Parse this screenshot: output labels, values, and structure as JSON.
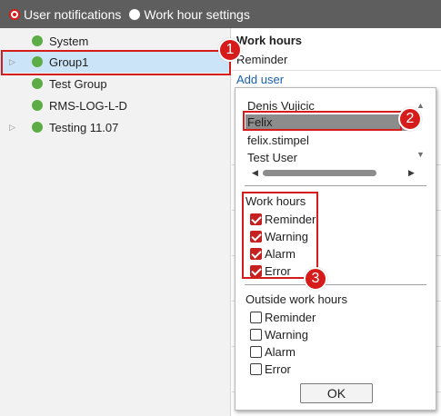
{
  "colors": {
    "topbar_bg": "#5e5e5e",
    "accent_red": "#d61b1b",
    "status_green": "#5cad45",
    "selected_row": "#cce4f7",
    "link_blue": "#1a5fb4"
  },
  "topbar": {
    "options": [
      {
        "label": "User notifications",
        "checked": true
      },
      {
        "label": "Work hour settings",
        "checked": false
      }
    ]
  },
  "tree": {
    "items": [
      {
        "label": "System",
        "expandable": false,
        "status": "green",
        "selected": false
      },
      {
        "label": "Group1",
        "expandable": true,
        "status": "green",
        "selected": true
      },
      {
        "label": "Test Group",
        "expandable": false,
        "status": "green",
        "selected": false
      },
      {
        "label": "RMS-LOG-L-D",
        "expandable": false,
        "status": "green",
        "selected": false
      },
      {
        "label": "Testing 11.07",
        "expandable": true,
        "status": "green",
        "selected": false
      }
    ]
  },
  "right_panel": {
    "heading": "Work hours",
    "reminder": "Reminder",
    "add_user": "Add user"
  },
  "popup": {
    "users": [
      "Denis Vujicic",
      "Felix",
      "felix.stimpel",
      "Test User"
    ],
    "highlighted_user": "Felix",
    "work_hours": {
      "title": "Work hours",
      "items": [
        {
          "label": "Reminder",
          "checked": true
        },
        {
          "label": "Warning",
          "checked": true
        },
        {
          "label": "Alarm",
          "checked": true
        },
        {
          "label": "Error",
          "checked": true
        }
      ]
    },
    "outside_work_hours": {
      "title": "Outside work hours",
      "items": [
        {
          "label": "Reminder",
          "checked": false
        },
        {
          "label": "Warning",
          "checked": false
        },
        {
          "label": "Alarm",
          "checked": false
        },
        {
          "label": "Error",
          "checked": false
        }
      ]
    },
    "ok_label": "OK"
  },
  "callouts": [
    "1",
    "2",
    "3"
  ]
}
